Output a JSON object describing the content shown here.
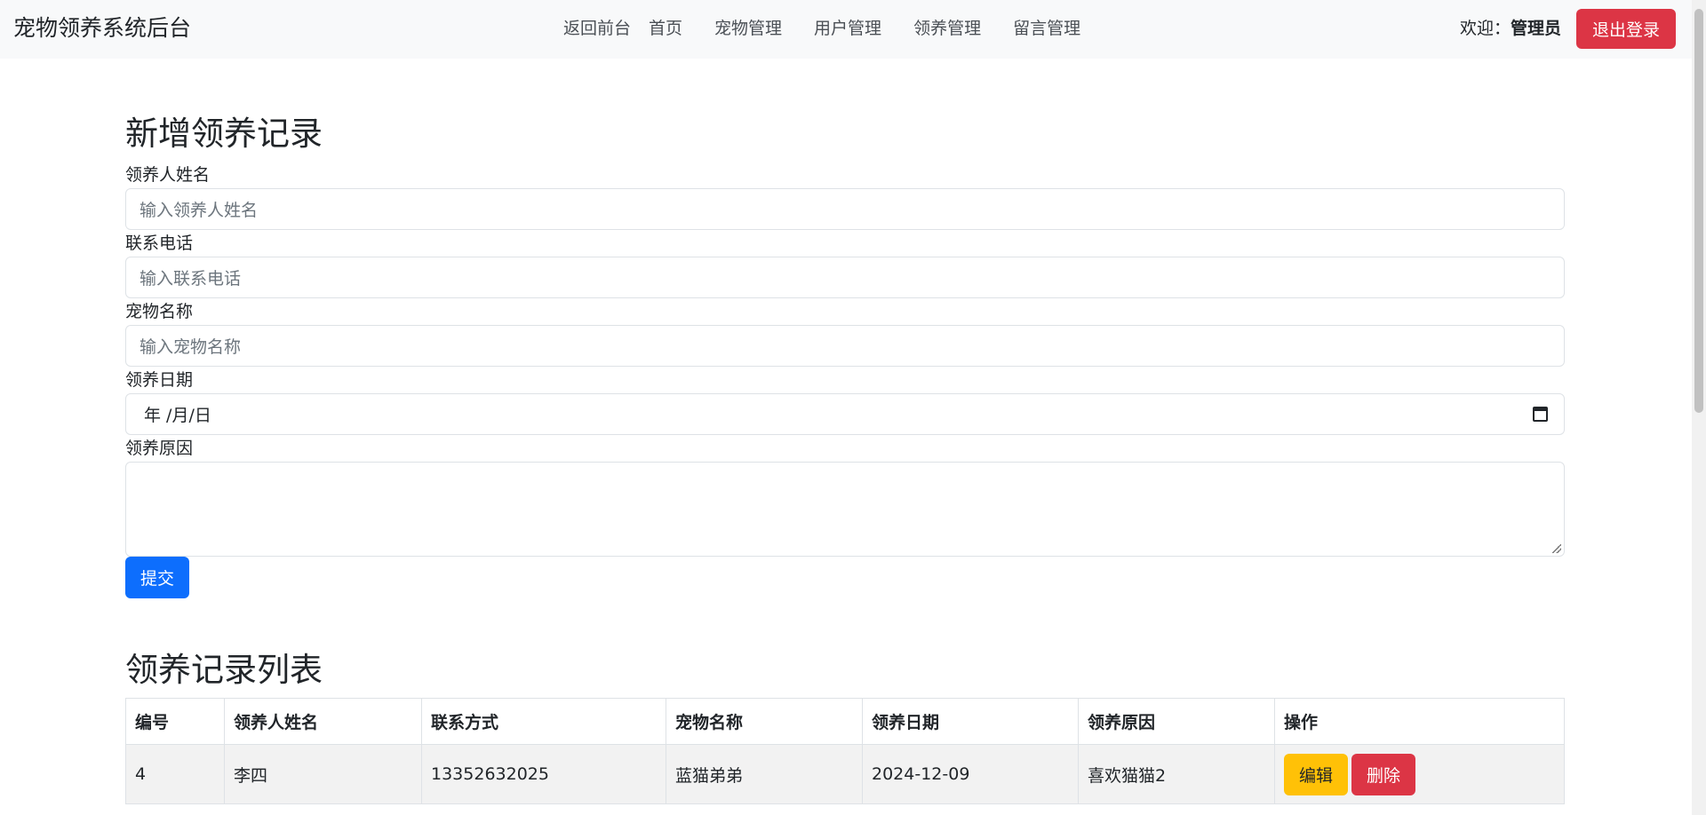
{
  "navbar": {
    "brand": "宠物领养系统后台",
    "links": [
      "返回前台",
      "首页",
      "宠物管理",
      "用户管理",
      "领养管理",
      "留言管理"
    ],
    "welcome_prefix": "欢迎：",
    "welcome_user": "管理员",
    "logout_label": "退出登录"
  },
  "form": {
    "title": "新增领养记录",
    "name_label": "领养人姓名",
    "name_placeholder": "输入领养人姓名",
    "phone_label": "联系电话",
    "phone_placeholder": "输入联系电话",
    "pet_label": "宠物名称",
    "pet_placeholder": "输入宠物名称",
    "date_label": "领养日期",
    "date_value": "年 /月/日",
    "reason_label": "领养原因",
    "reason_value": "",
    "submit_label": "提交"
  },
  "table": {
    "title": "领养记录列表",
    "headers": [
      "编号",
      "领养人姓名",
      "联系方式",
      "宠物名称",
      "领养日期",
      "领养原因",
      "操作"
    ],
    "rows": [
      {
        "id": "4",
        "name": "李四",
        "phone": "13352632025",
        "pet": "蓝猫弟弟",
        "date": "2024-12-09",
        "reason": "喜欢猫猫2",
        "edit_label": "编辑",
        "delete_label": "删除"
      }
    ]
  },
  "colors": {
    "primary": "#0d6efd",
    "danger": "#dc3545",
    "warning": "#ffc107",
    "navbar_bg": "#f8f9fa"
  }
}
